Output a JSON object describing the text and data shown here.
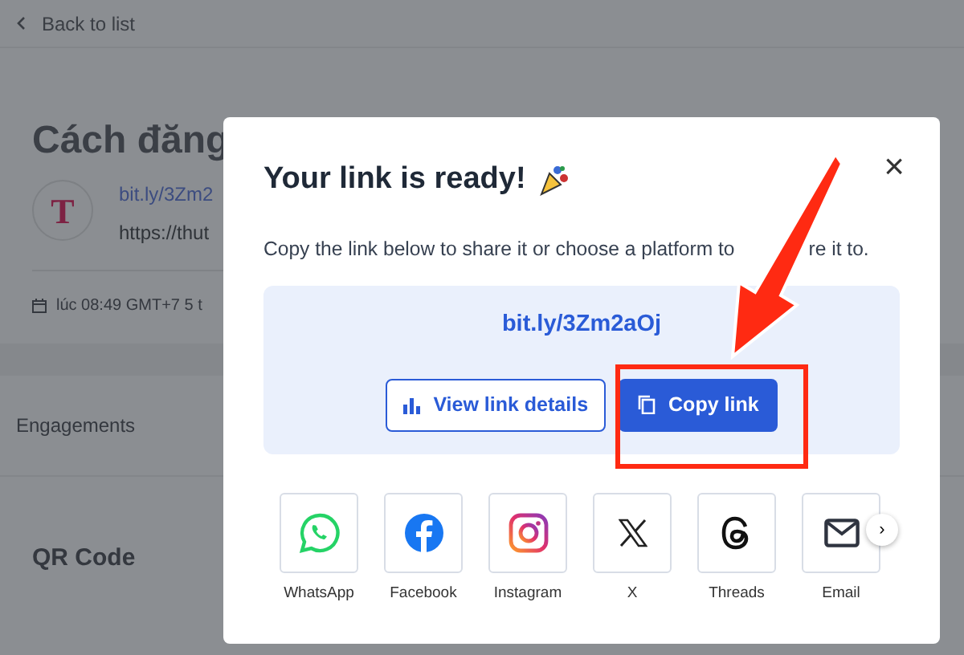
{
  "page": {
    "back_link": "Back to list",
    "title": "Cách đăng",
    "avatar_letter": "T",
    "short_link": "bit.ly/3Zm2",
    "long_url": "https://thut",
    "date": "lúc 08:49 GMT+7 5 t",
    "engagements": "Engagements",
    "qr_code": "QR Code"
  },
  "modal": {
    "title": "Your link is ready!",
    "close": "×",
    "description": [
      "Copy the link below to share it or choose a platform to",
      "re it to."
    ],
    "link": "bit.ly/3Zm2aOj",
    "buttons": [
      {
        "kind": "details",
        "label": "View link details"
      },
      {
        "kind": "copy",
        "label": "Copy link"
      }
    ],
    "share": [
      {
        "kind": "whatsapp",
        "label": "WhatsApp"
      },
      {
        "kind": "facebook",
        "label": "Facebook"
      },
      {
        "kind": "instagram",
        "label": "Instagram"
      },
      {
        "kind": "x",
        "label": "X"
      },
      {
        "kind": "threads",
        "label": "Threads"
      },
      {
        "kind": "email",
        "label": "Email"
      }
    ],
    "next": "›"
  }
}
